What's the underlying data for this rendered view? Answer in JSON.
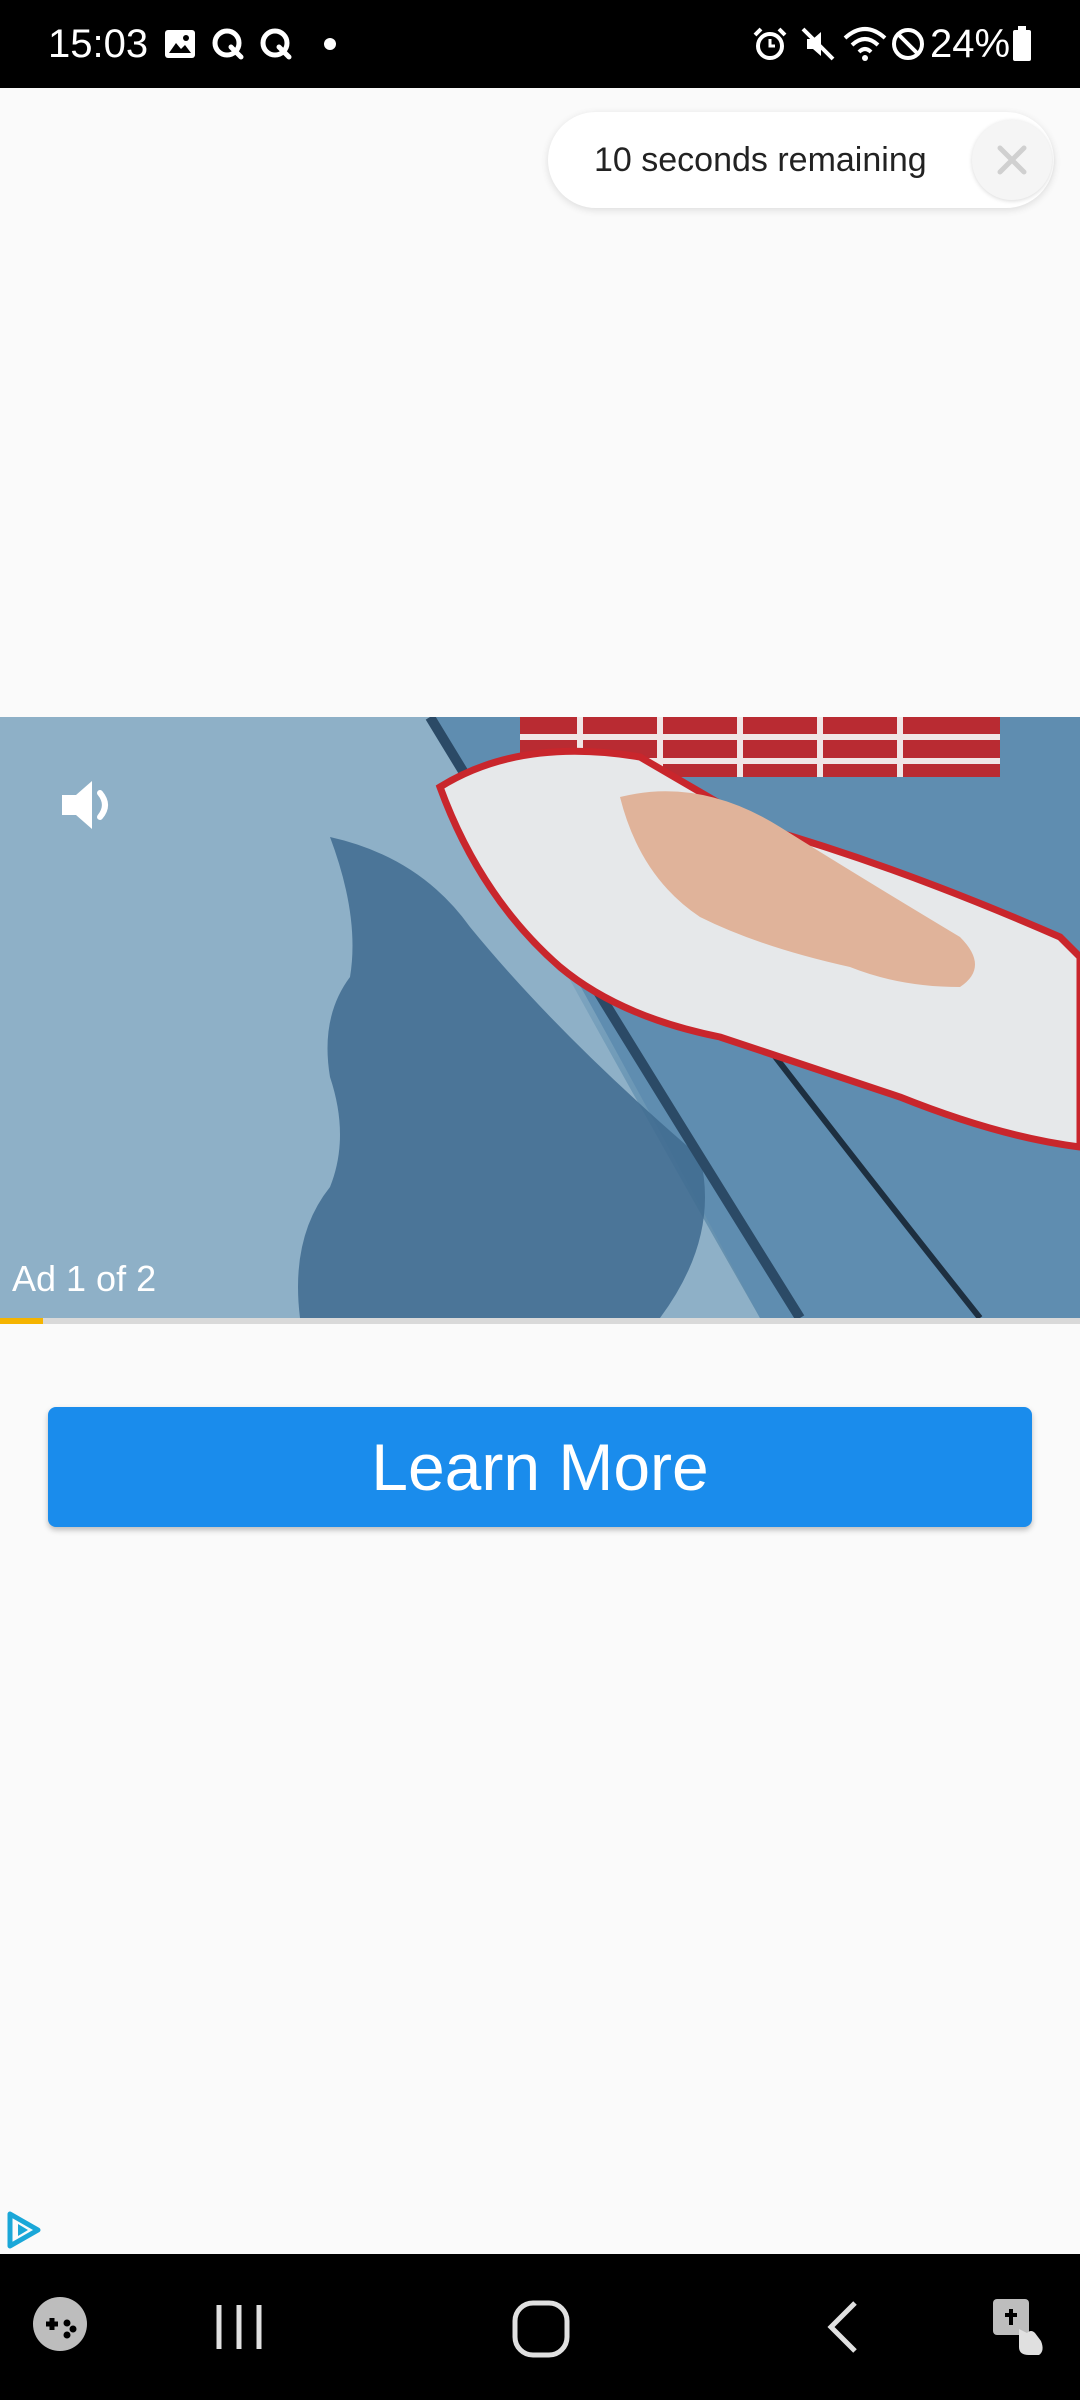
{
  "status_bar": {
    "time": "15:03",
    "battery": "24%",
    "left_icons": [
      "gallery-icon",
      "q-app-icon",
      "q-app-icon",
      "notification-dot-icon"
    ],
    "right_icons": [
      "alarm-icon",
      "mute-icon",
      "wifi-icon",
      "do-not-disturb-icon",
      "battery-icon"
    ]
  },
  "ad": {
    "skip_text": "10 seconds remaining",
    "close_icon": "close-icon",
    "counter": "Ad 1 of 2",
    "volume_icon": "volume-icon",
    "progress_fraction": 0.04,
    "progress_color": "#f5b400",
    "cta_label": "Learn More",
    "cta_color": "#1a8cec",
    "adchoices_icon": "adchoices-icon"
  },
  "nav_bar": {
    "icons": [
      "game-launcher-icon",
      "recent-apps-icon",
      "home-icon",
      "back-icon",
      "accessibility-icon"
    ]
  }
}
